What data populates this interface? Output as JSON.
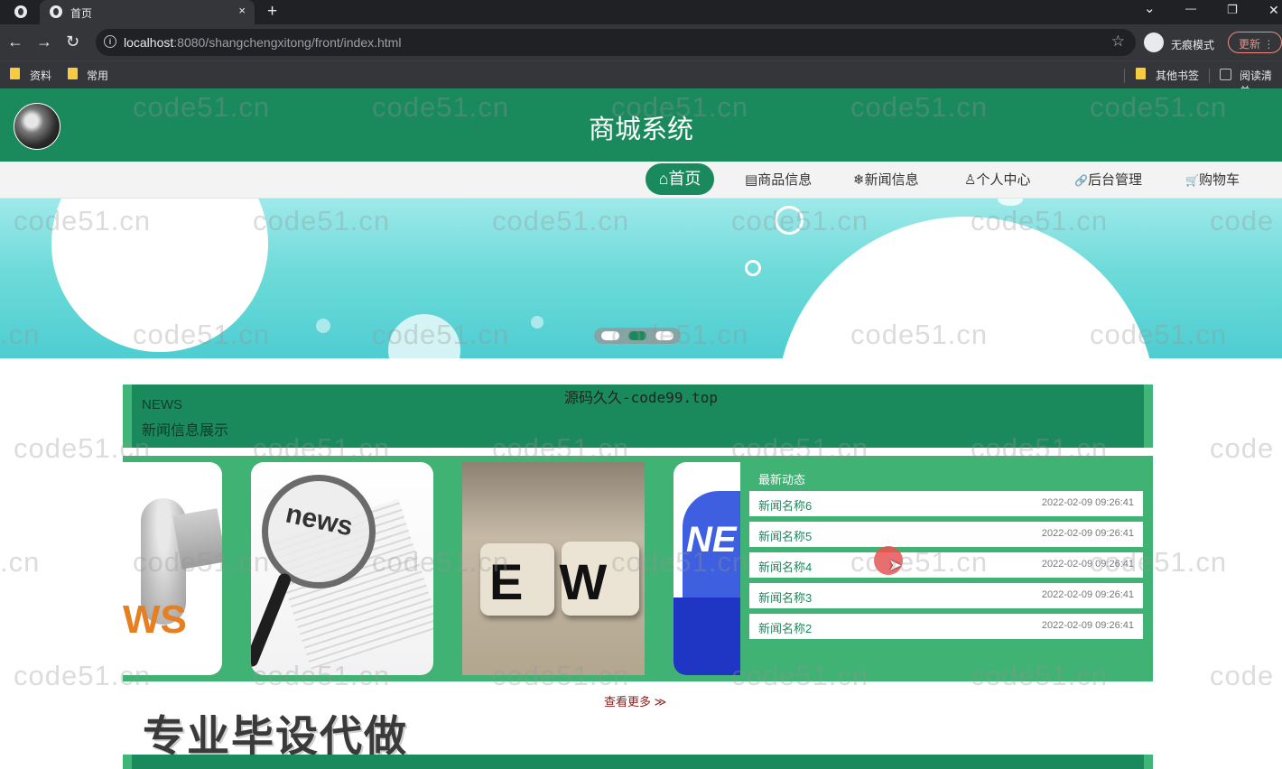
{
  "browser": {
    "tab_title": "首页",
    "tab_close": "×",
    "new_tab": "+",
    "url_host": "localhost",
    "url_rest": ":8080/shangchengxitong/front/index.html",
    "incognito_label": "无痕模式",
    "update_label": "更新",
    "bookmarks": [
      "资料",
      "常用"
    ],
    "other_bookmarks": "其他书签",
    "reading_list": "阅读清单",
    "window_controls": {
      "minimize": "—",
      "restore": "❐",
      "close": "✕",
      "dropdown": "⌄"
    }
  },
  "site": {
    "title": "商城系统",
    "nav": [
      {
        "icon": "⌂",
        "label": "首页",
        "active": true
      },
      {
        "icon": "▤",
        "label": "商品信息"
      },
      {
        "icon": "❄",
        "label": "新闻信息"
      },
      {
        "icon": "♙",
        "label": "个人中心"
      },
      {
        "icon": "🔗",
        "label": "后台管理"
      },
      {
        "icon": "🛒",
        "label": "购物车"
      }
    ]
  },
  "watermarks": {
    "main": "code51.cn",
    "main_partial_left": ".cn",
    "main_partial_right": "code",
    "top_center": "源码久久-code99.top"
  },
  "news_section": {
    "en_title": "NEWS",
    "cn_title": "新闻信息展示",
    "latest_title": "最新动态",
    "latest_items": [
      {
        "name": "新闻名称6",
        "time": "2022-02-09 09:26:41"
      },
      {
        "name": "新闻名称5",
        "time": "2022-02-09 09:26:41"
      },
      {
        "name": "新闻名称4",
        "time": "2022-02-09 09:26:41"
      },
      {
        "name": "新闻名称3",
        "time": "2022-02-09 09:26:41"
      },
      {
        "name": "新闻名称2",
        "time": "2022-02-09 09:26:41"
      }
    ],
    "card_texts": {
      "news": "news",
      "ews": "EW",
      "ne": "NE",
      "ws": "WS"
    },
    "more_label": "查看更多 ≫"
  },
  "promo_text": "专业毕设代做",
  "banner": {
    "active_slide": 2,
    "slide_count": 3
  },
  "colors": {
    "primary": "#1a8a5d",
    "light_green": "#3fb274",
    "banner_cyan": "#6edbd9"
  }
}
